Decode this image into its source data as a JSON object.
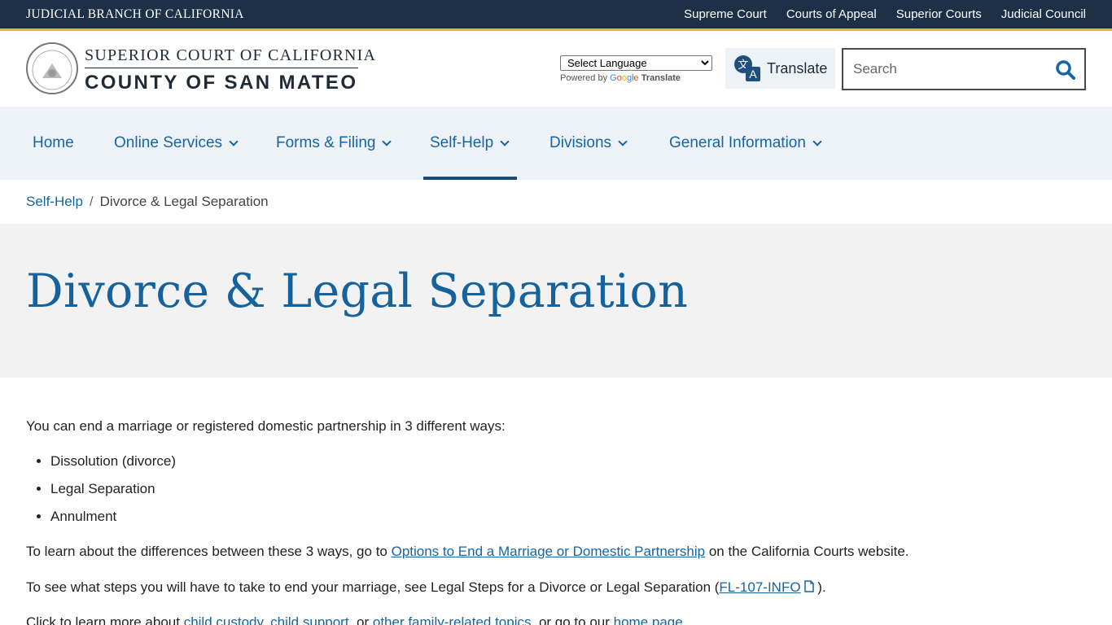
{
  "topbar": {
    "title": "JUDICIAL BRANCH OF CALIFORNIA",
    "links": [
      "Supreme Court",
      "Courts of Appeal",
      "Superior Courts",
      "Judicial Council"
    ]
  },
  "header": {
    "logo_line1": "SUPERIOR COURT OF CALIFORNIA",
    "logo_line2": "COUNTY OF SAN MATEO",
    "seal_text": "JUDICIAL BRANCH OF CALIFORNIA",
    "language_select": "Select Language",
    "powered_by": "Powered by",
    "google": [
      "G",
      "o",
      "o",
      "g",
      "l",
      "e"
    ],
    "powered_translate": "Translate",
    "translate_button": "Translate",
    "search_placeholder": "Search"
  },
  "nav": {
    "items": [
      {
        "label": "Home"
      },
      {
        "label": "Online Services"
      },
      {
        "label": "Forms & Filing"
      },
      {
        "label": "Self-Help"
      },
      {
        "label": "Divisions"
      },
      {
        "label": "General Information"
      }
    ]
  },
  "breadcrumb": {
    "parent": "Self-Help",
    "separator": "/",
    "current": "Divorce & Legal Separation"
  },
  "page": {
    "title": "Divorce & Legal Separation"
  },
  "content": {
    "intro": "You can end a marriage or registered domestic partnership in 3 different ways:",
    "bullets": [
      "Dissolution (divorce)",
      "Legal Separation",
      "Annulment"
    ],
    "learn_pre": "To learn about the differences between these 3 ways, go to ",
    "learn_link": "Options to End a Marriage or Domestic Partnership",
    "learn_post": " on the California Courts website.",
    "steps_pre": "To see what steps you will have to take to end your marriage, see Legal Steps for a Divorce or Legal Separation (",
    "steps_link": "FL-107-INFO",
    "steps_post": " ).",
    "click_pre": "Click to learn more about ",
    "click_link1": "child custody",
    "click_comma": ", ",
    "click_link2": "child support",
    "click_or": ", or ",
    "click_link3": "other family-related topics",
    "click_mid": ", or go to our ",
    "click_link4": "home page",
    "click_end": "."
  },
  "colors": {
    "topbar_bg": "#1e3047",
    "accent_gold": "#e8b53a",
    "link_blue": "#1565a3",
    "nav_bg": "#edf2f9",
    "hero_bg": "#f2f2f2"
  }
}
